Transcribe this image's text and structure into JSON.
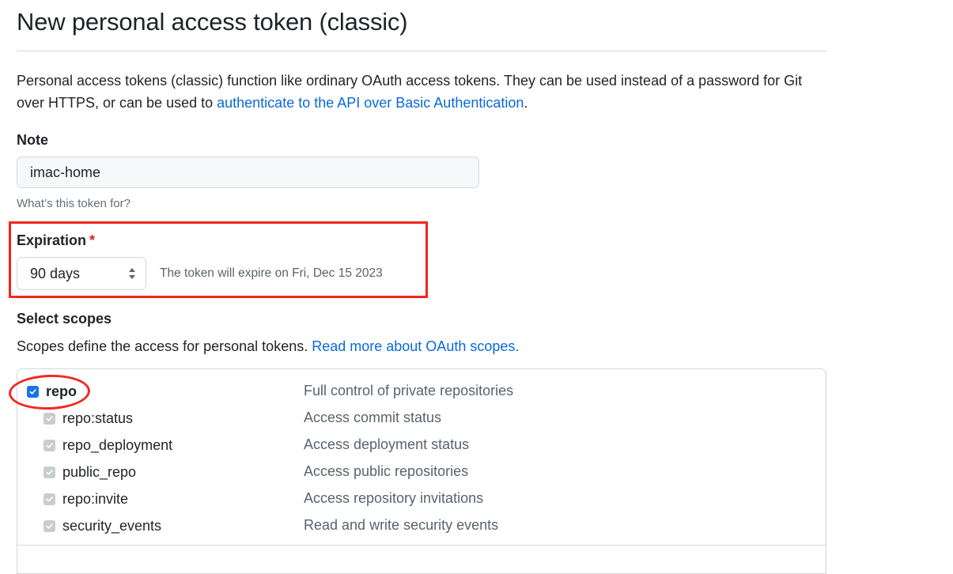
{
  "page": {
    "title": "New personal access token (classic)",
    "intro_text": "Personal access tokens (classic) function like ordinary OAuth access tokens. They can be used instead of a password for Git over HTTPS, or can be used to ",
    "intro_link": "authenticate to the API over Basic Authentication",
    "intro_end": "."
  },
  "note": {
    "label": "Note",
    "value": "imac-home",
    "hint": "What’s this token for?"
  },
  "expiration": {
    "label": "Expiration",
    "required_mark": "*",
    "selected": "90 days",
    "expire_note": "The token will expire on Fri, Dec 15 2023"
  },
  "scopes": {
    "label": "Select scopes",
    "description": "Scopes define the access for personal tokens. ",
    "link": "Read more about OAuth scopes.",
    "items": [
      {
        "name": "repo",
        "description": "Full control of private repositories",
        "checked": true,
        "parent": true
      },
      {
        "name": "repo:status",
        "description": "Access commit status",
        "checked": true,
        "parent": false
      },
      {
        "name": "repo_deployment",
        "description": "Access deployment status",
        "checked": true,
        "parent": false
      },
      {
        "name": "public_repo",
        "description": "Access public repositories",
        "checked": true,
        "parent": false
      },
      {
        "name": "repo:invite",
        "description": "Access repository invitations",
        "checked": true,
        "parent": false
      },
      {
        "name": "security_events",
        "description": "Read and write security events",
        "checked": true,
        "parent": false
      }
    ]
  },
  "colors": {
    "link": "#0969da",
    "annotation_red": "#f0271c",
    "checkbox_active": "#1a73e8",
    "checkbox_disabled": "#c9cdd2"
  }
}
